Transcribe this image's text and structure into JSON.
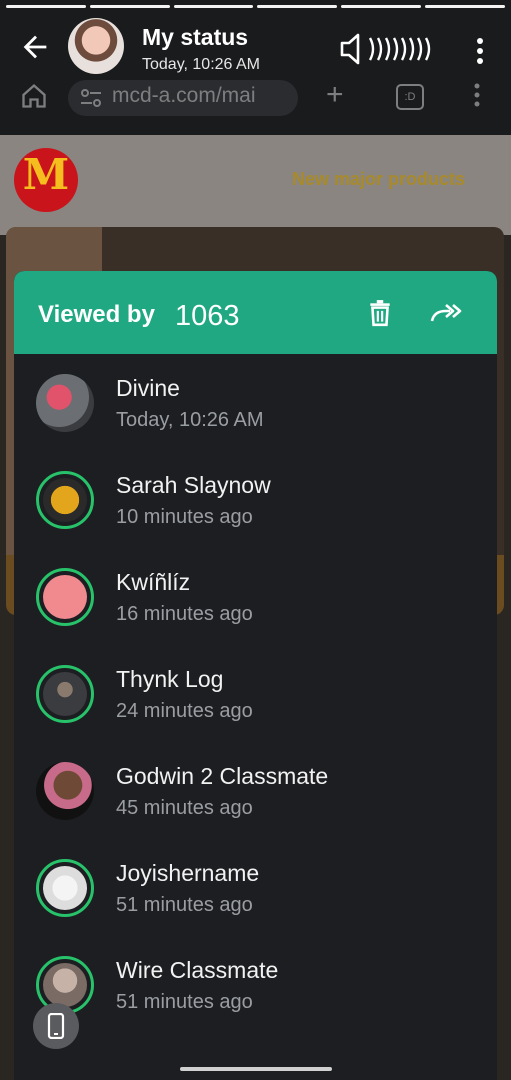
{
  "status": {
    "title": "My status",
    "time": "Today, 10:26 AM"
  },
  "browser": {
    "url": "mcd-a.com/mai",
    "tabs_label": ":D"
  },
  "page": {
    "logo_letter": "M",
    "nav_link": "New major products"
  },
  "panel": {
    "viewed_by_label": "Viewed by",
    "viewed_count": "1063",
    "accent_color": "#1fa882",
    "ring_color": "#27c26a"
  },
  "viewers": [
    {
      "name": "Divine",
      "time": "Today, 10:26 AM"
    },
    {
      "name": "Sarah Slaynow",
      "time": "10 minutes ago"
    },
    {
      "name": "Kwíñlíz",
      "time": "16 minutes ago"
    },
    {
      "name": "Thynk Log",
      "time": "24 minutes ago"
    },
    {
      "name": "Godwin 2 Classmate",
      "time": "45 minutes ago"
    },
    {
      "name": "Joyishername",
      "time": "51 minutes ago"
    },
    {
      "name": "Wire Classmate",
      "time": "51 minutes ago"
    }
  ],
  "icons": {
    "back": "arrow-left-icon",
    "speaker": "speaker-sound-icon",
    "menu": "more-vertical-icon",
    "delete": "trash-icon",
    "forward": "forward-icon",
    "phone": "phone-icon"
  }
}
